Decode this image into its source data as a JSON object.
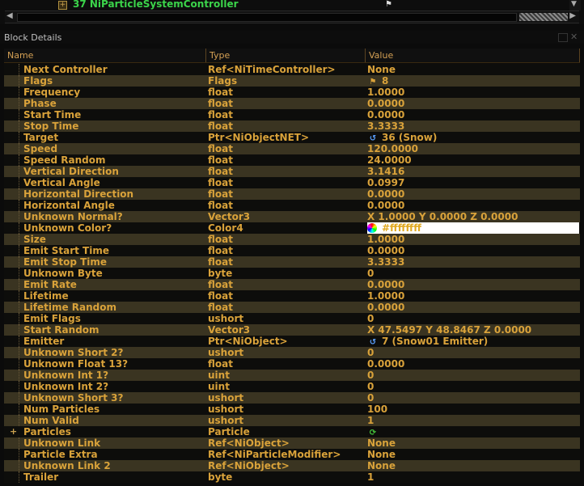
{
  "top_tree": {
    "expander": "+",
    "label": "37 NiParticleSystemController",
    "flag_glyph": "⚑"
  },
  "dock": {
    "title": "Block Details"
  },
  "table": {
    "headers": [
      "Name",
      "Type",
      "Value"
    ],
    "rows": [
      {
        "name": "Next Controller",
        "type": "Ref<NiTimeController>",
        "value": "None"
      },
      {
        "name": "Flags",
        "type": "Flags",
        "value": "8",
        "icon": "⚑"
      },
      {
        "name": "Frequency",
        "type": "float",
        "value": "1.0000"
      },
      {
        "name": "Phase",
        "type": "float",
        "value": "0.0000"
      },
      {
        "name": "Start Time",
        "type": "float",
        "value": "0.0000"
      },
      {
        "name": "Stop Time",
        "type": "float",
        "value": "3.3333"
      },
      {
        "name": "Target",
        "type": "Ptr<NiObjectNET>",
        "value": "36 (Snow)",
        "icon": "↺"
      },
      {
        "name": "Speed",
        "type": "float",
        "value": "120.0000"
      },
      {
        "name": "Speed Random",
        "type": "float",
        "value": "24.0000"
      },
      {
        "name": "Vertical Direction",
        "type": "float",
        "value": "3.1416"
      },
      {
        "name": "Vertical Angle",
        "type": "float",
        "value": "0.0997"
      },
      {
        "name": "Horizontal Direction",
        "type": "float",
        "value": "0.0000"
      },
      {
        "name": "Horizontal Angle",
        "type": "float",
        "value": "0.0000"
      },
      {
        "name": "Unknown Normal?",
        "type": "Vector3",
        "value": "X 1.0000 Y 0.0000 Z 0.0000"
      },
      {
        "name": "Unknown Color?",
        "type": "Color4",
        "value": "#ffffffff",
        "color": true
      },
      {
        "name": "Size",
        "type": "float",
        "value": "1.0000"
      },
      {
        "name": "Emit Start Time",
        "type": "float",
        "value": "0.0000"
      },
      {
        "name": "Emit Stop Time",
        "type": "float",
        "value": "3.3333"
      },
      {
        "name": "Unknown Byte",
        "type": "byte",
        "value": "0"
      },
      {
        "name": "Emit Rate",
        "type": "float",
        "value": "0.0000"
      },
      {
        "name": "Lifetime",
        "type": "float",
        "value": "1.0000"
      },
      {
        "name": "Lifetime Random",
        "type": "float",
        "value": "0.0000"
      },
      {
        "name": "Emit Flags",
        "type": "ushort",
        "value": "0"
      },
      {
        "name": "Start Random",
        "type": "Vector3",
        "value": "X 47.5497 Y 48.8467 Z 0.0000"
      },
      {
        "name": "Emitter",
        "type": "Ptr<NiObject>",
        "value": "7 (Snow01 Emitter)",
        "icon": "↺"
      },
      {
        "name": "Unknown Short 2?",
        "type": "ushort",
        "value": "0"
      },
      {
        "name": "Unknown Float 13?",
        "type": "float",
        "value": "0.0000"
      },
      {
        "name": "Unknown Int 1?",
        "type": "uint",
        "value": "0"
      },
      {
        "name": "Unknown Int 2?",
        "type": "uint",
        "value": "0"
      },
      {
        "name": "Unknown Short 3?",
        "type": "ushort",
        "value": "0"
      },
      {
        "name": "Num Particles",
        "type": "ushort",
        "value": "100"
      },
      {
        "name": "Num Valid",
        "type": "ushort",
        "value": "1"
      },
      {
        "name": "Particles",
        "type": "Particle",
        "value": "",
        "icon": "⟳",
        "expander": "+"
      },
      {
        "name": "Unknown Link",
        "type": "Ref<NiObject>",
        "value": "None"
      },
      {
        "name": "Particle Extra",
        "type": "Ref<NiParticleModifier>",
        "value": "None"
      },
      {
        "name": "Unknown Link 2",
        "type": "Ref<NiObject>",
        "value": "None"
      },
      {
        "name": "Trailer",
        "type": "byte",
        "value": "1"
      }
    ]
  }
}
